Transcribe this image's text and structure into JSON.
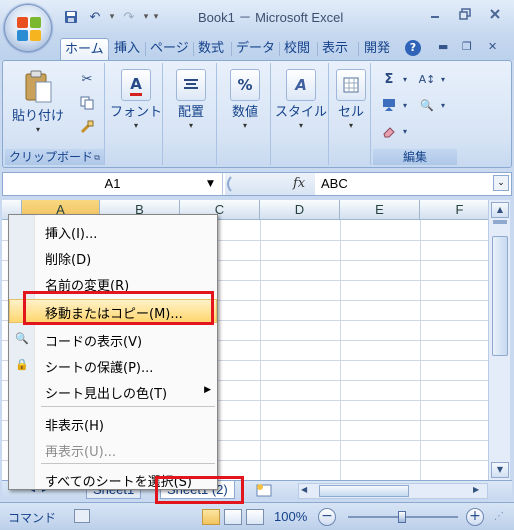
{
  "window": {
    "title": "Book1 － Microsoft Excel"
  },
  "qat": {
    "undo": "↶",
    "redo": "↷"
  },
  "tabs": [
    "ホーム",
    "挿入",
    "ページ",
    "数式",
    "データ",
    "校閲",
    "表示",
    "開発"
  ],
  "ribbon": {
    "groups": {
      "clipboard": {
        "label": "クリップボード",
        "paste": "貼り付け"
      },
      "font": {
        "label": "フォント",
        "icon": "A"
      },
      "align": {
        "label": "配置"
      },
      "number": {
        "label": "数値",
        "icon": "%"
      },
      "style": {
        "label": "スタイル",
        "icon": "A"
      },
      "cell": {
        "label": "セル"
      },
      "edit": {
        "label": "編集"
      }
    }
  },
  "formula_bar": {
    "name_box": "A1",
    "fx": "fx",
    "value": "ABC"
  },
  "grid": {
    "columns": [
      "A",
      "B",
      "C",
      "D",
      "E",
      "F"
    ]
  },
  "context_menu": {
    "items": [
      {
        "label": "挿入(I)...",
        "enabled": true
      },
      {
        "label": "削除(D)",
        "enabled": true
      },
      {
        "label": "名前の変更(R)",
        "enabled": true
      },
      {
        "label": "移動またはコピー(M)...",
        "enabled": true,
        "highlighted": true
      },
      {
        "label": "コードの表示(V)",
        "enabled": true
      },
      {
        "label": "シートの保護(P)...",
        "enabled": true
      },
      {
        "label": "シート見出しの色(T)",
        "enabled": true,
        "submenu": true
      },
      {
        "label": "非表示(H)",
        "enabled": true
      },
      {
        "label": "再表示(U)...",
        "enabled": false
      },
      {
        "label": "すべてのシートを選択(S)",
        "enabled": true
      }
    ]
  },
  "sheet_tabs": [
    "Sheet1",
    "Sheet1 (2)"
  ],
  "status": {
    "mode": "コマンド",
    "zoom": "100%"
  },
  "colors": {
    "highlight_box": "#e2141c",
    "selected_header": "#f1c15f"
  }
}
